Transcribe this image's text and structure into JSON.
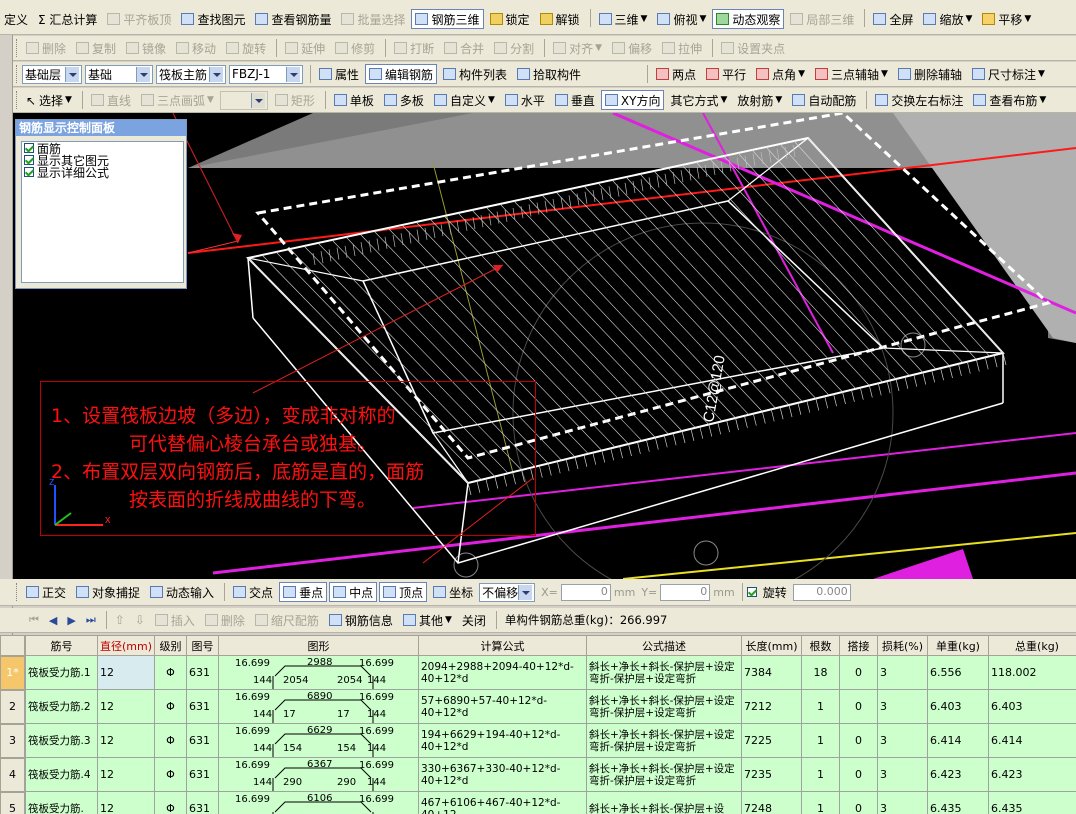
{
  "menubar": {
    "items": [
      "定义",
      "Σ 汇总计算",
      "平齐板顶",
      "查找图元",
      "查看钢筋量",
      "批量选择",
      "钢筋三维",
      "锁定",
      "解锁",
      "三维",
      "俯视",
      "动态观察",
      "局部三维",
      "全屏",
      "缩放",
      "平移"
    ]
  },
  "toolbar2": {
    "items": [
      "删除",
      "复制",
      "镜像",
      "移动",
      "旋转",
      "延伸",
      "修剪",
      "打断",
      "合并",
      "分割",
      "对齐",
      "偏移",
      "拉伸",
      "设置夹点"
    ]
  },
  "toolbar3": {
    "floor": "基础层",
    "category": "基础",
    "type": "筏板主筋",
    "component": "FBZJ-1",
    "items": [
      "属性",
      "编辑钢筋",
      "构件列表",
      "拾取构件",
      "两点",
      "平行",
      "点角",
      "三点辅轴",
      "删除辅轴",
      "尺寸标注"
    ]
  },
  "toolbar4": {
    "items": [
      "选择",
      "直线",
      "三点画弧",
      "矩形",
      "单板",
      "多板",
      "自定义",
      "水平",
      "垂直",
      "XY方向",
      "其它方式",
      "放射筋",
      "自动配筋",
      "交换左右标注",
      "查看布筋"
    ]
  },
  "panel": {
    "title": "钢筋显示控制面板",
    "options": [
      "面筋",
      "显示其它图元",
      "显示详细公式"
    ]
  },
  "note": {
    "line1": "1、设置筏板边坡（多边），变成非对称的",
    "line2": "可代替偏心棱台承台或独基。",
    "line3": "2、布置双层双向钢筋后，底筋是直的，面筋",
    "line4": "按表面的折线成曲线的下弯。"
  },
  "viewport": {
    "rebar_label": "C12@120"
  },
  "statusbar": {
    "items": [
      "正交",
      "对象捕捉",
      "动态输入",
      "交点",
      "垂点",
      "中点",
      "顶点",
      "坐标"
    ],
    "offset_mode": "不偏移",
    "x_label": "X=",
    "x_value": "0",
    "y_label": "Y=",
    "y_value": "0",
    "unit": "mm",
    "rotate_label": "旋转",
    "rotate_value": "0.000"
  },
  "gridbar": {
    "items": [
      "插入",
      "删除",
      "缩尺配筋",
      "钢筋信息",
      "其他",
      "关闭"
    ],
    "total_weight": "单构件钢筋总重(kg)：266.997"
  },
  "table": {
    "headers": [
      "筋号",
      "直径(mm)",
      "级别",
      "图号",
      "图形",
      "计算公式",
      "公式描述",
      "长度(mm)",
      "根数",
      "搭接",
      "损耗(%)",
      "单重(kg)",
      "总重(kg)"
    ],
    "rows": [
      {
        "idx": "1*",
        "name": "筏板受力筋.1",
        "dia": "12",
        "grade": "Φ",
        "fig": "631",
        "shape": {
          "tl": "16.699",
          "top": "2988",
          "tr": "16.699",
          "bl": "144",
          "bm1": "2054",
          "bm2": "2054",
          "br": "144"
        },
        "formula": "2094+2988+2094-40+12*d-40+12*d",
        "desc": "斜长+净长+斜长-保护层+设定弯折-保护层+设定弯折",
        "len": "7384",
        "count": "18",
        "lap": "0",
        "loss": "3",
        "unit_w": "6.556",
        "total_w": "118.002"
      },
      {
        "idx": "2",
        "name": "筏板受力筋.2",
        "dia": "12",
        "grade": "Φ",
        "fig": "631",
        "shape": {
          "tl": "16.699",
          "top": "6890",
          "tr": "16.699",
          "bl": "144",
          "bm1": "17",
          "bm2": "17",
          "br": "144"
        },
        "formula": "57+6890+57-40+12*d-40+12*d",
        "desc": "斜长+净长+斜长-保护层+设定弯折-保护层+设定弯折",
        "len": "7212",
        "count": "1",
        "lap": "0",
        "loss": "3",
        "unit_w": "6.403",
        "total_w": "6.403"
      },
      {
        "idx": "3",
        "name": "筏板受力筋.3",
        "dia": "12",
        "grade": "Φ",
        "fig": "631",
        "shape": {
          "tl": "16.699",
          "top": "6629",
          "tr": "16.699",
          "bl": "144",
          "bm1": "154",
          "bm2": "154",
          "br": "144"
        },
        "formula": "194+6629+194-40+12*d-40+12*d",
        "desc": "斜长+净长+斜长-保护层+设定弯折-保护层+设定弯折",
        "len": "7225",
        "count": "1",
        "lap": "0",
        "loss": "3",
        "unit_w": "6.414",
        "total_w": "6.414"
      },
      {
        "idx": "4",
        "name": "筏板受力筋.4",
        "dia": "12",
        "grade": "Φ",
        "fig": "631",
        "shape": {
          "tl": "16.699",
          "top": "6367",
          "tr": "16.699",
          "bl": "144",
          "bm1": "290",
          "bm2": "290",
          "br": "144"
        },
        "formula": "330+6367+330-40+12*d-40+12*d",
        "desc": "斜长+净长+斜长-保护层+设定弯折-保护层+设定弯折",
        "len": "7235",
        "count": "1",
        "lap": "0",
        "loss": "3",
        "unit_w": "6.423",
        "total_w": "6.423"
      },
      {
        "idx": "5",
        "name": "筏板受力筋.",
        "dia": "12",
        "grade": "Φ",
        "fig": "631",
        "shape": {
          "tl": "16.699",
          "top": "6106",
          "tr": "16.699",
          "bl": "",
          "bm1": "",
          "bm2": "",
          "br": ""
        },
        "formula": "467+6106+467-40+12*d-40+12",
        "desc": "斜长+净长+斜长-保护层+设",
        "len": "7248",
        "count": "1",
        "lap": "0",
        "loss": "3",
        "unit_w": "6.435",
        "total_w": "6.435"
      }
    ]
  },
  "colors": {
    "accent": "#0a246a",
    "note_red": "#ff1010",
    "grid_green": "#ccffcc",
    "viewport_bg": "#000000"
  }
}
